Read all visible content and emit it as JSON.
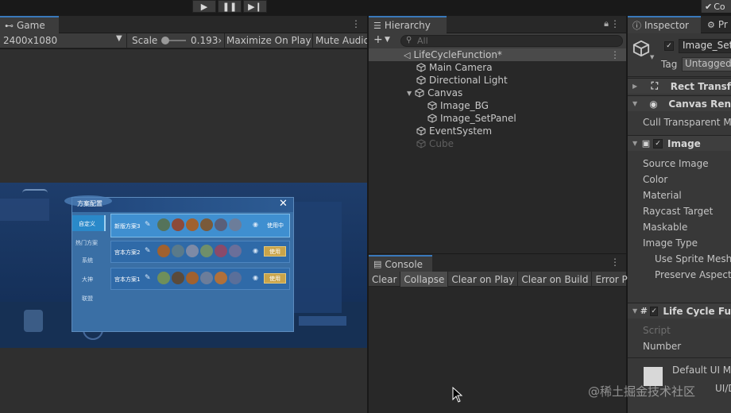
{
  "colors": {
    "accent": "#3a79bb",
    "selection": "#4a4a4a",
    "panel": "#282828",
    "toolbar": "#3c3c3c",
    "game_bg": "#1d3a66",
    "dialog_bg": "#3a6fa5",
    "gold": "#c9a44a"
  },
  "toolbar": {
    "play_icon": "play-icon",
    "pause_icon": "pause-icon",
    "step_icon": "step-icon",
    "collab_label": "Co"
  },
  "game": {
    "tab_label": "Game",
    "resolution": "2400x1080",
    "scale_label": "Scale",
    "scale_value": "0.193›",
    "maximize_label": "Maximize On Play",
    "mute_label": "Mute Audio",
    "dialog": {
      "title": "方案配置",
      "close_glyph": "✕",
      "sidebar": [
        "自定义",
        "热门方案",
        "系统",
        "大神",
        "联盟"
      ],
      "rows": [
        {
          "label": "新版方案3",
          "action": "使用中"
        },
        {
          "label": "宫本方案2",
          "action": "使用"
        },
        {
          "label": "宫本方案1",
          "action": "使用"
        }
      ]
    }
  },
  "hierarchy": {
    "tab_label": "Hierarchy",
    "search_placeholder": "All",
    "scene": "LifeCycleFunction*",
    "items": [
      {
        "label": "Main Camera"
      },
      {
        "label": "Directional Light"
      },
      {
        "label": "Canvas"
      },
      {
        "label": "Image_BG"
      },
      {
        "label": "Image_SetPanel"
      },
      {
        "label": "EventSystem"
      },
      {
        "label": "Cube"
      }
    ]
  },
  "console": {
    "tab_label": "Console",
    "buttons": [
      "Clear",
      "Collapse",
      "Clear on Play",
      "Clear on Build",
      "Error Pau"
    ]
  },
  "inspector": {
    "tab_label": "Inspector",
    "tab2_label": "Pr",
    "object_name": "Image_Set",
    "tag_label": "Tag",
    "tag_value": "Untagged",
    "components": {
      "rect_transform": "Rect Transf",
      "canvas_renderer": "Canvas Ren",
      "cull_transparent": "Cull Transparent Me",
      "image": "Image",
      "image_props": [
        "Source Image",
        "Color",
        "Material",
        "Raycast Target",
        "Maskable",
        "Image Type"
      ],
      "image_sub_props": [
        "Use Sprite Mesh",
        "Preserve Aspect"
      ],
      "life_cycle": "Life Cycle Fu",
      "script_label": "Script",
      "number_label": "Number",
      "material_name": "Default UI M",
      "material_shader": "UI/D"
    }
  },
  "watermark": "@稀土掘金技术社区"
}
